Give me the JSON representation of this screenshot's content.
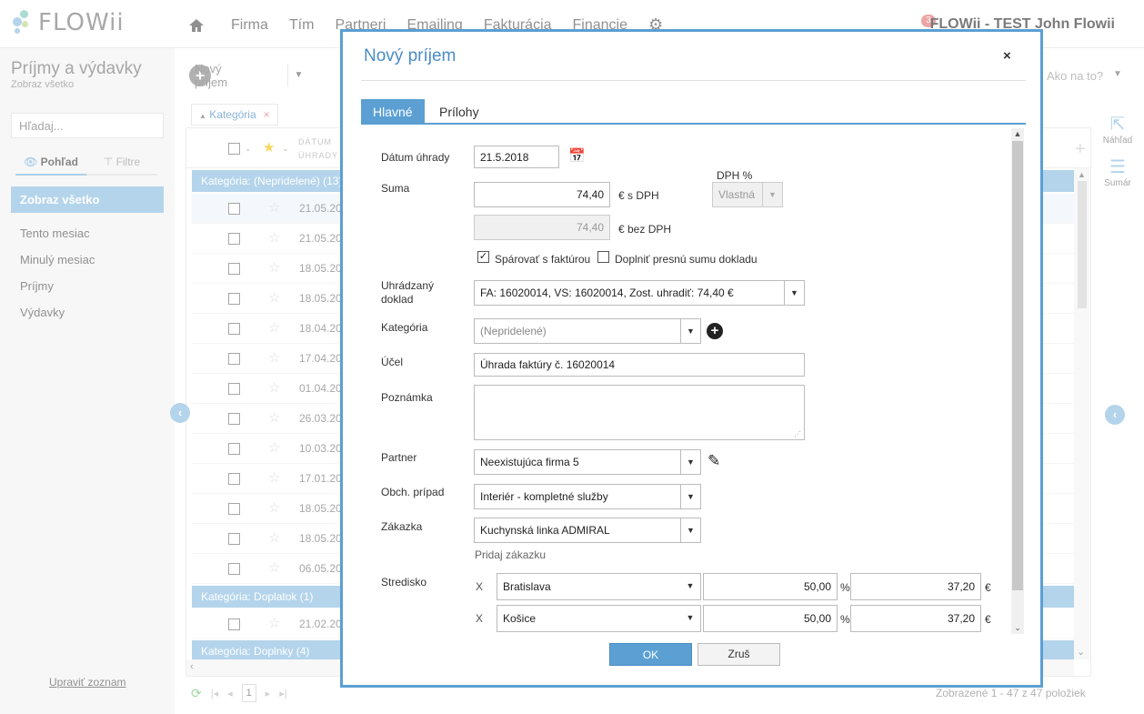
{
  "app": {
    "logo": "FLOWii",
    "user": "FLOWii - TEST John Flowii",
    "notifications": "3"
  },
  "nav": [
    "Firma",
    "Tím",
    "Partneri",
    "Emailing",
    "Fakturácia",
    "Financie"
  ],
  "left": {
    "title": "Príjmy a výdavky",
    "subtitle": "Zobraz všetko",
    "search_placeholder": "Hľadaj...",
    "tabs": [
      "Pohľad",
      "Filtre"
    ],
    "menu": [
      "Zobraz všetko",
      "Tento mesiac",
      "Minulý mesiac",
      "Príjmy",
      "Výdavky"
    ],
    "edit_list": "Upraviť zoznam"
  },
  "toolbar": {
    "new_label": "Nový príjem",
    "howto": "Ako na to?"
  },
  "filter_chip": "Kategória",
  "grid": {
    "header_date": [
      "DÁTUM",
      "ÚHRADY"
    ],
    "groups": [
      "Kategória: (Nepridelené) (13)",
      "Kategória: Doplatok (1)",
      "Kategória: Doplnky (4)"
    ],
    "dates": [
      "21.05.20",
      "21.05.20",
      "18.05.20",
      "18.05.20",
      "18.04.20",
      "17.04.20",
      "01.04.20",
      "26.03.20",
      "10.03.20",
      "17.01.20",
      "18.05.20",
      "18.05.20",
      "06.05.20"
    ],
    "dates_group2": [
      "21.02.20"
    ]
  },
  "pager": {
    "page": "1",
    "info": "Zobrazené 1 - 47 z 47 položiek"
  },
  "side": {
    "preview": "Náhľad",
    "summary": "Sumár"
  },
  "modal": {
    "title": "Nový príjem",
    "close": "×",
    "tabs": [
      "Hlavné",
      "Prílohy"
    ],
    "labels": {
      "date": "Dátum úhrady",
      "amount": "Suma",
      "vat_pct": "DPH %",
      "paid_doc_1": "Uhrádzaný",
      "paid_doc_2": "doklad",
      "category": "Kategória",
      "purpose": "Účel",
      "note": "Poznámka",
      "partner": "Partner",
      "deal": "Obch. prípad",
      "order": "Zákazka",
      "center": "Stredisko"
    },
    "values": {
      "date": "21.5.2018",
      "amount_with_vat": "74,40",
      "amount_without_vat": "74,40",
      "currency_with": "€  s DPH",
      "currency_without": "€  bez DPH",
      "vat_select": "Vlastná",
      "pair_invoice": "Spárovať s faktúrou",
      "fill_exact": "Doplniť presnú sumu dokladu",
      "paid_doc": "FA: 16020014, VS: 16020014, Zost. uhradiť: 74,40 €",
      "category": "(Nepridelené)",
      "purpose": "Úhrada faktúry č. 16020014",
      "note": "",
      "partner": "Neexistujúca firma 5",
      "deal": "Interiér - kompletné služby",
      "order": "Kuchynská linka ADMIRAL",
      "add_order": "Pridaj zákazku"
    },
    "centers": [
      {
        "x": "X",
        "name": "Bratislava",
        "pct": "50,00",
        "pct_unit": "%",
        "amount": "37,20",
        "cur": "€"
      },
      {
        "x": "X",
        "name": "Košice",
        "pct": "50,00",
        "pct_unit": "%",
        "amount": "37,20",
        "cur": "€"
      }
    ],
    "ok": "OK",
    "cancel": "Zruš"
  },
  "colors": {
    "accent": "#5b9fd3",
    "group": "#8dbde0"
  }
}
